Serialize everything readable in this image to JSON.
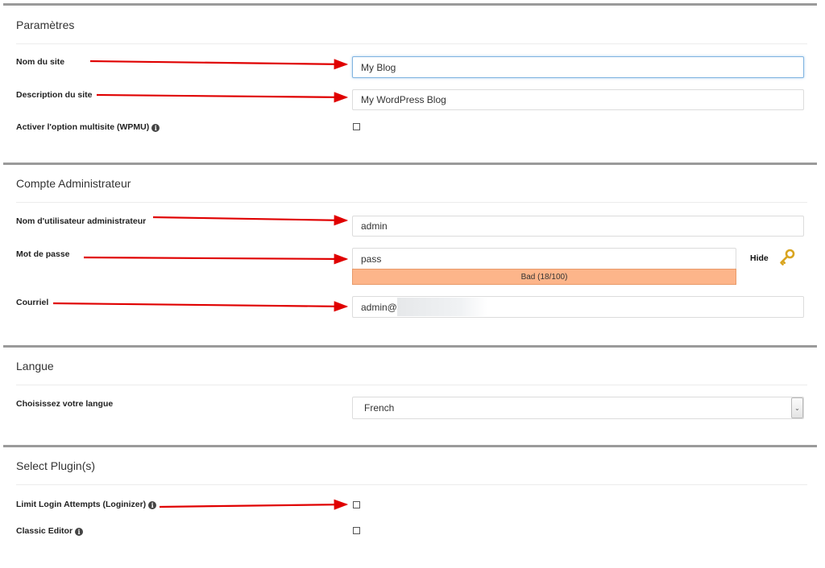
{
  "settings": {
    "title": "Paramètres",
    "site_name_label": "Nom du site",
    "site_name_value": "My Blog",
    "site_desc_label": "Description du site",
    "site_desc_value": "My WordPress Blog",
    "multisite_label": "Activer l'option multisite (WPMU)"
  },
  "admin": {
    "title": "Compte Administrateur",
    "username_label": "Nom d'utilisateur administrateur",
    "username_value": "admin",
    "password_label": "Mot de passe",
    "password_value": "pass",
    "hide_label": "Hide",
    "strength_text": "Bad (18/100)",
    "strength_color": "#fdb58a",
    "email_label": "Courriel",
    "email_value": "admin@"
  },
  "language": {
    "title": "Langue",
    "choose_label": "Choisissez votre langue",
    "selected": "French"
  },
  "plugins": {
    "title": "Select Plugin(s)",
    "items": [
      {
        "label": "Limit Login Attempts (Loginizer)"
      },
      {
        "label": "Classic Editor"
      }
    ]
  },
  "colors": {
    "arrow": "#e00000",
    "section_border": "#9a9a9a",
    "focus": "#7fb3e0"
  },
  "icons": {
    "info": "info-icon",
    "key": "key-icon",
    "arrow": "red-arrow-annotation"
  }
}
